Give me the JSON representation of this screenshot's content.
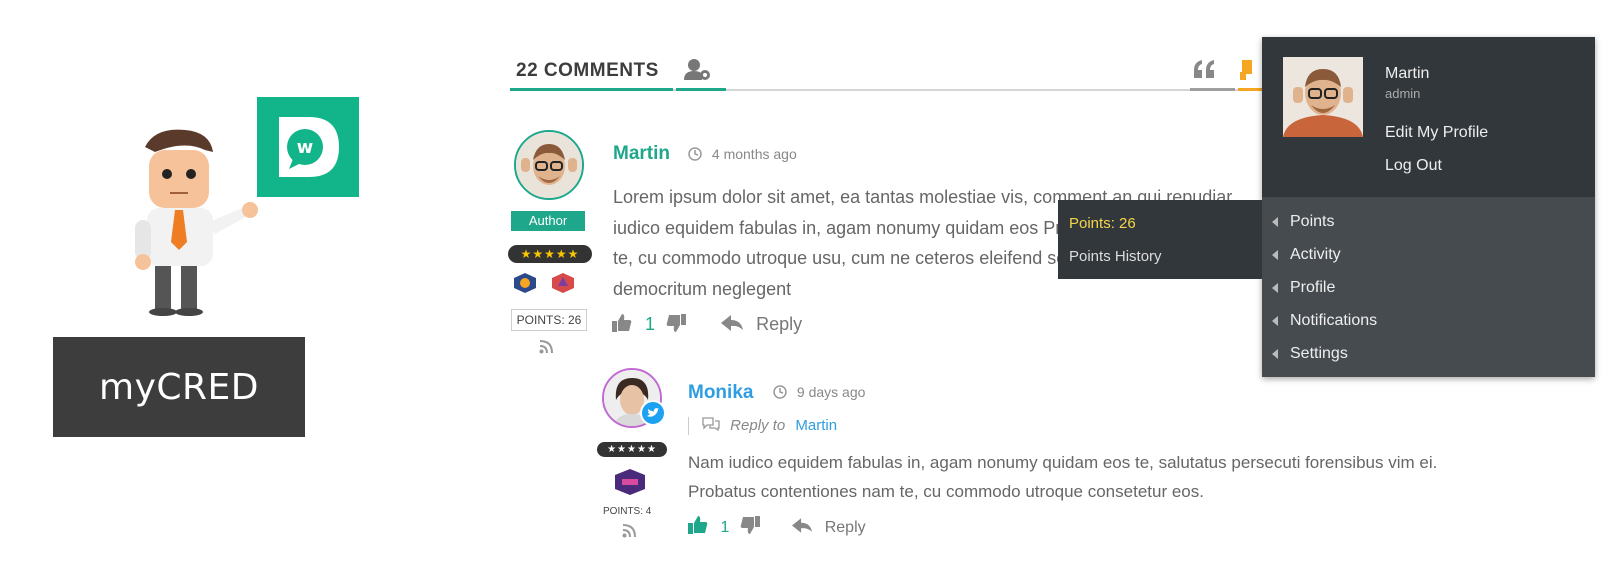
{
  "branding": {
    "mycred_label": "myCRED",
    "wpd_letter": "D",
    "wpd_small": "w"
  },
  "header": {
    "comments_tab": "22 COMMENTS"
  },
  "comments": [
    {
      "author": "Martin",
      "time": "4 months ago",
      "badge": "Author",
      "stars": "★★★★★",
      "points": "POINTS: 26",
      "text": "Lorem ipsum dolor sit amet, ea tantas molestiae vis, comment an qui repudiar iudico equidem fabulas in, agam nonumy quidam eos Probatus contentiones nam te, cu commodo utroque usu, cum ne ceteros eleifend sententiae, vis commune democritum neglegent",
      "votes": "1",
      "reply_label": "Reply"
    },
    {
      "author": "Monika",
      "time": "9 days ago",
      "stars": "★★★★★",
      "points": "POINTS: 4",
      "reply_to_label": "Reply to",
      "reply_to_name": "Martin",
      "text": "Nam iudico equidem fabulas in, agam nonumy quidam eos te, salutatus persecuti forensibus vim ei. Probatus contentiones nam te, cu commodo utroque consetetur eos.",
      "votes": "1",
      "reply_label": "Reply"
    }
  ],
  "admin_menu": {
    "name": "Martin",
    "role": "admin",
    "edit_profile": "Edit My Profile",
    "logout": "Log Out",
    "items": [
      "Points",
      "Activity",
      "Profile",
      "Notifications",
      "Settings"
    ],
    "points_submenu": {
      "points": "Points: 26",
      "history": "Points History"
    }
  },
  "colors": {
    "accent": "#1ea78a",
    "link_blue": "#2f9de1",
    "admin_bg": "#32373c",
    "admin_bg_lower": "#464b50",
    "points_yellow": "#f5d64a"
  }
}
